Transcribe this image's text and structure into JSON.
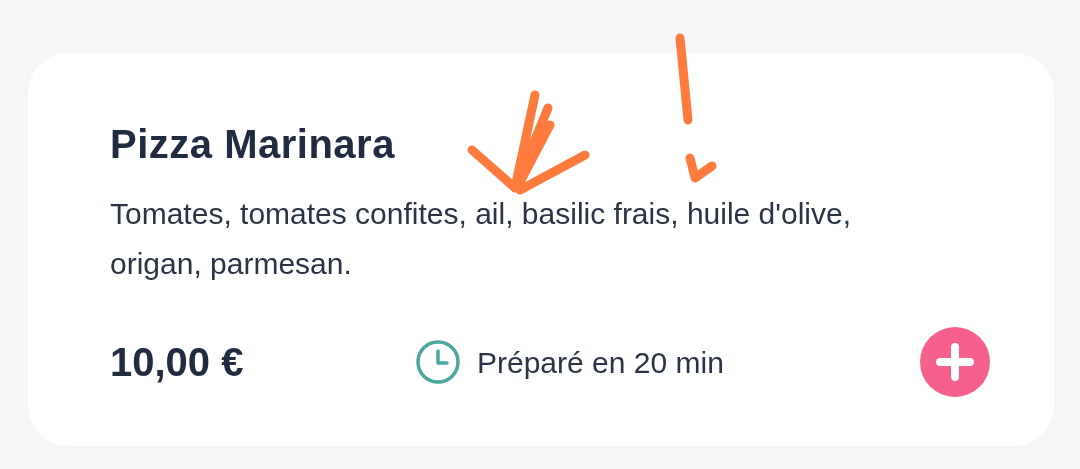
{
  "dish": {
    "name": "Pizza Marinara",
    "description": "Tomates, tomates confites, ail, basilic frais, huile d'olive, origan, parmesan.",
    "price": "10,00 €",
    "prep_time": "Préparé en 20 min"
  }
}
